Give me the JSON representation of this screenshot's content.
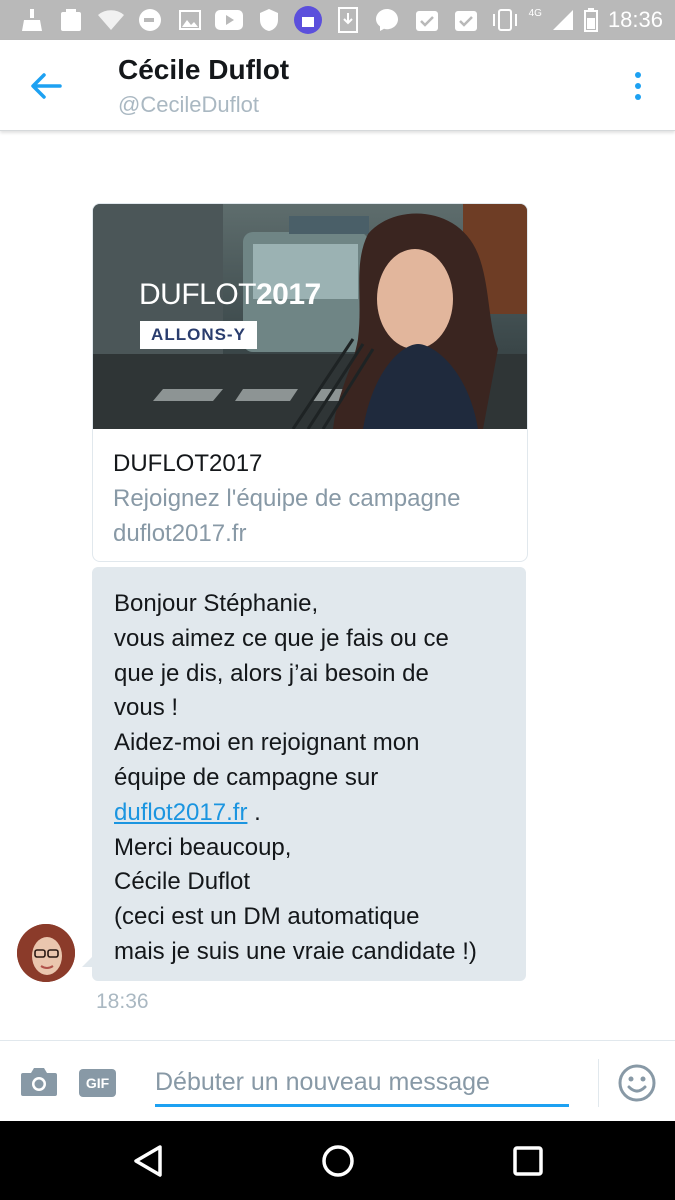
{
  "status_bar": {
    "time": "18:36",
    "network": "4G",
    "icons": [
      "broom-icon",
      "clipboard-icon",
      "wifi-icon",
      "exit-icon",
      "image-icon",
      "youtube-icon",
      "shield-icon",
      "app-icon",
      "download-icon",
      "messenger-icon",
      "check-icon",
      "check-icon",
      "vibrate-icon",
      "signal-icon",
      "battery-icon"
    ]
  },
  "header": {
    "title": "Cécile Duflot",
    "handle": "@CecileDuflot"
  },
  "card": {
    "brand_prefix": "DUFLOT",
    "brand_year": "2017",
    "tagline": "ALLONS-Y",
    "title": "DUFLOT2017",
    "description": "Rejoignez l'équipe de campagne",
    "domain": "duflot2017.fr"
  },
  "message": {
    "lines": [
      "Bonjour Stéphanie,",
      "vous aimez ce que je fais ou ce",
      "que je dis, alors j’ai besoin de",
      "vous !",
      "Aidez-moi en rejoignant mon",
      "équipe de campagne sur"
    ],
    "link": "duflot2017.fr",
    "link_suffix": " .",
    "closing_lines": [
      "Merci beaucoup,",
      "Cécile Duflot",
      "(ceci est un DM automatique",
      "mais je suis une vraie candidate !)"
    ],
    "time": "18:36"
  },
  "composer": {
    "placeholder": "Débuter un nouveau message",
    "gif_label": "GIF"
  },
  "colors": {
    "accent": "#1da1f2",
    "bubble": "#e1e8ed",
    "muted": "#8899a6",
    "status_bar": "#b9b9b9"
  }
}
